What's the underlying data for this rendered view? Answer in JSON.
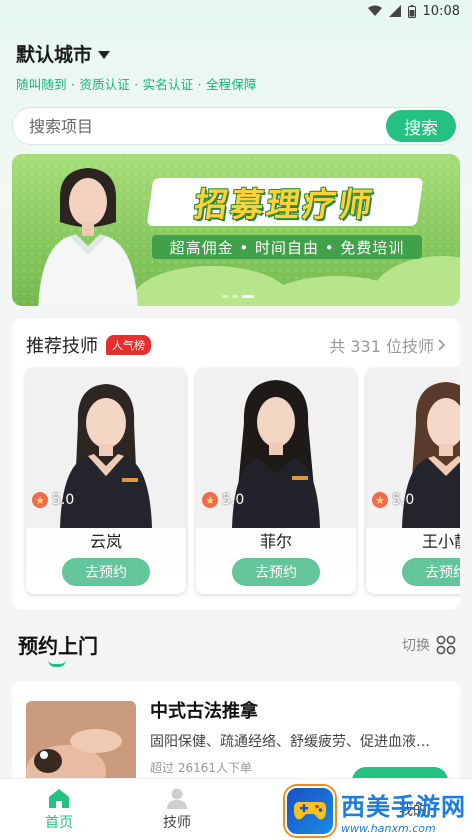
{
  "status": {
    "time": "10:08"
  },
  "header": {
    "city": "默认城市",
    "tagline": "随叫随到 · 资质认证 · 实名认证 · 全程保障"
  },
  "search": {
    "placeholder": "搜索项目",
    "button": "搜索"
  },
  "banner": {
    "title": "招募理疗师",
    "subtitle": "超高佣金 • 时间自由 • 免费培训",
    "slides": 3,
    "active_slide": 2
  },
  "recommend": {
    "title": "推荐技师",
    "badge": "人气榜",
    "count_text": "共 331 位技师",
    "technicians": [
      {
        "name": "云岚",
        "rating": "5.0",
        "button": "去预约"
      },
      {
        "name": "菲尔",
        "rating": "5.0",
        "button": "去预约"
      },
      {
        "name": "王小静",
        "rating": "5.0",
        "button": "去预约"
      }
    ]
  },
  "booking": {
    "title": "预约上门",
    "switch_label": "切换"
  },
  "services": [
    {
      "name": "中式古法推拿",
      "desc": "固阳保健、疏通经络、舒缓疲劳、促进血液…",
      "orders": "超过 26161人下单"
    }
  ],
  "tabs": [
    {
      "label": "首页",
      "active": true
    },
    {
      "label": "技师",
      "active": false
    },
    {
      "label": "",
      "active": false
    },
    {
      "label": "我的",
      "active": false
    }
  ],
  "watermark": {
    "name": "西美手游网",
    "url": "www.hanxm.com"
  },
  "colors": {
    "accent": "#25c183",
    "badge": "#e52e2e",
    "button_soft": "#65c59a"
  }
}
